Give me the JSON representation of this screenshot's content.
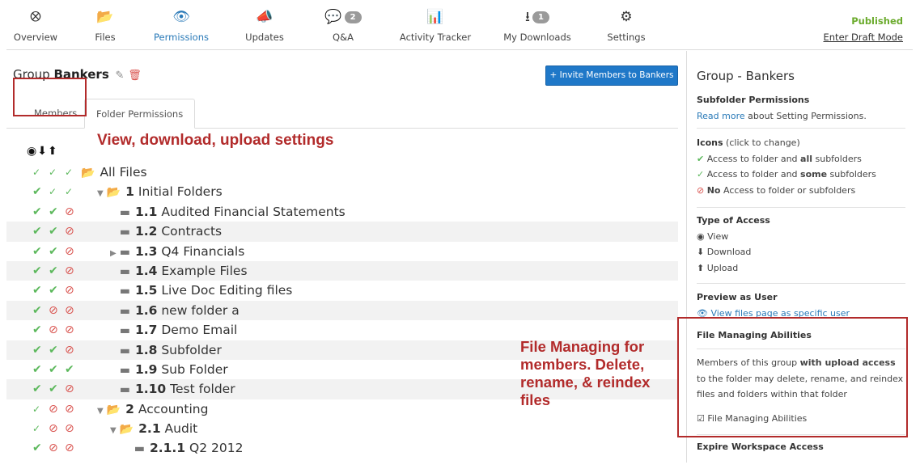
{
  "nav": {
    "items": [
      {
        "label": "Overview",
        "icon": "compass-icon",
        "glyph": "⭙",
        "badge": ""
      },
      {
        "label": "Files",
        "icon": "folder-icon",
        "glyph": "📂",
        "badge": ""
      },
      {
        "label": "Permissions",
        "icon": "eye-icon",
        "glyph": "👁",
        "badge": ""
      },
      {
        "label": "Updates",
        "icon": "megaphone-icon",
        "glyph": "📣",
        "badge": ""
      },
      {
        "label": "Q&A",
        "icon": "chat-icon",
        "glyph": "💬",
        "badge": "2"
      },
      {
        "label": "Activity Tracker",
        "icon": "bar-chart-icon",
        "glyph": "📊",
        "badge": ""
      },
      {
        "label": "My Downloads",
        "icon": "download-icon",
        "glyph": "⭳",
        "badge": "1"
      },
      {
        "label": "Settings",
        "icon": "gear-icon",
        "glyph": "⚙",
        "badge": ""
      }
    ],
    "status": "Published",
    "draft_link": "Enter Draft Mode"
  },
  "main": {
    "group_prefix": "Group",
    "group_name": "Bankers",
    "invite_button": "+ Invite Members to Bankers",
    "tabs": [
      "Members",
      "Folder Permissions"
    ],
    "type_icons": "◉⬇⬆"
  },
  "annotations": {
    "top": "View, download, upload settings",
    "bottom_lines": [
      "File Managing for",
      "members. Delete,",
      "rename, & reindex",
      "files"
    ]
  },
  "tree": [
    {
      "num": "",
      "name": "All Files",
      "level": 0,
      "caret": "",
      "perm": [
        "some",
        "some",
        "some"
      ],
      "shaded": false
    },
    {
      "num": "1",
      "name": "Initial Folders",
      "level": 1,
      "caret": "▼",
      "perm": [
        "all",
        "some",
        "some"
      ],
      "shaded": false
    },
    {
      "num": "1.1",
      "name": "Audited Financial Statements",
      "level": 2,
      "caret": "",
      "perm": [
        "all",
        "all",
        "none"
      ],
      "shaded": false
    },
    {
      "num": "1.2",
      "name": "Contracts",
      "level": 2,
      "caret": "",
      "perm": [
        "all",
        "all",
        "none"
      ],
      "shaded": true
    },
    {
      "num": "1.3",
      "name": "Q4 Financials",
      "level": 2,
      "caret": "▶",
      "perm": [
        "all",
        "all",
        "none"
      ],
      "shaded": false
    },
    {
      "num": "1.4",
      "name": "Example Files",
      "level": 2,
      "caret": "",
      "perm": [
        "all",
        "all",
        "none"
      ],
      "shaded": true
    },
    {
      "num": "1.5",
      "name": "Live Doc Editing files",
      "level": 2,
      "caret": "",
      "perm": [
        "all",
        "all",
        "none"
      ],
      "shaded": false
    },
    {
      "num": "1.6",
      "name": "new folder a",
      "level": 2,
      "caret": "",
      "perm": [
        "all",
        "none",
        "none"
      ],
      "shaded": true
    },
    {
      "num": "1.7",
      "name": "Demo Email",
      "level": 2,
      "caret": "",
      "perm": [
        "all",
        "none",
        "none"
      ],
      "shaded": false
    },
    {
      "num": "1.8",
      "name": "Subfolder",
      "level": 2,
      "caret": "",
      "perm": [
        "all",
        "all",
        "none"
      ],
      "shaded": true
    },
    {
      "num": "1.9",
      "name": "Sub Folder",
      "level": 2,
      "caret": "",
      "perm": [
        "all",
        "all",
        "all"
      ],
      "shaded": false
    },
    {
      "num": "1.10",
      "name": "Test folder",
      "level": 2,
      "caret": "",
      "perm": [
        "all",
        "all",
        "none"
      ],
      "shaded": true
    },
    {
      "num": "2",
      "name": "Accounting",
      "level": 1,
      "caret": "▼",
      "perm": [
        "some",
        "none",
        "none"
      ],
      "shaded": false
    },
    {
      "num": "2.1",
      "name": "Audit",
      "level": 2,
      "caret": "▼",
      "perm": [
        "some",
        "none",
        "none"
      ],
      "shaded": false
    },
    {
      "num": "2.1.1",
      "name": "Q2 2012",
      "level": 3,
      "caret": "",
      "perm": [
        "all",
        "none",
        "none"
      ],
      "shaded": false
    }
  ],
  "sidebar": {
    "title": "Group - Bankers",
    "subfolder_heading": "Subfolder Permissions",
    "read_more_link": "Read more",
    "read_more_rest": " about Setting Permissions.",
    "icons_heading": "Icons",
    "icons_hint": " (click to change)",
    "legend": [
      {
        "pre": "Access to folder and ",
        "bold": "all",
        "post": " subfolders"
      },
      {
        "pre": "Access to folder and ",
        "bold": "some",
        "post": " subfolders"
      },
      {
        "pre": "",
        "bold": "No",
        "post": " Access to folder or subfolders"
      }
    ],
    "type_heading": "Type of Access",
    "types": [
      "View",
      "Download",
      "Upload"
    ],
    "preview_heading": "Preview as User",
    "preview_link": "View files page as specific user",
    "fm_heading": "File Managing Abilities",
    "fm_desc_pre": "Members of this group ",
    "fm_desc_bold": "with upload access",
    "fm_desc_post": " to the folder may delete, rename, and reindex files and folders within that folder",
    "fm_checkbox": "File Managing Abilities",
    "expire_heading": "Expire Workspace Access"
  }
}
